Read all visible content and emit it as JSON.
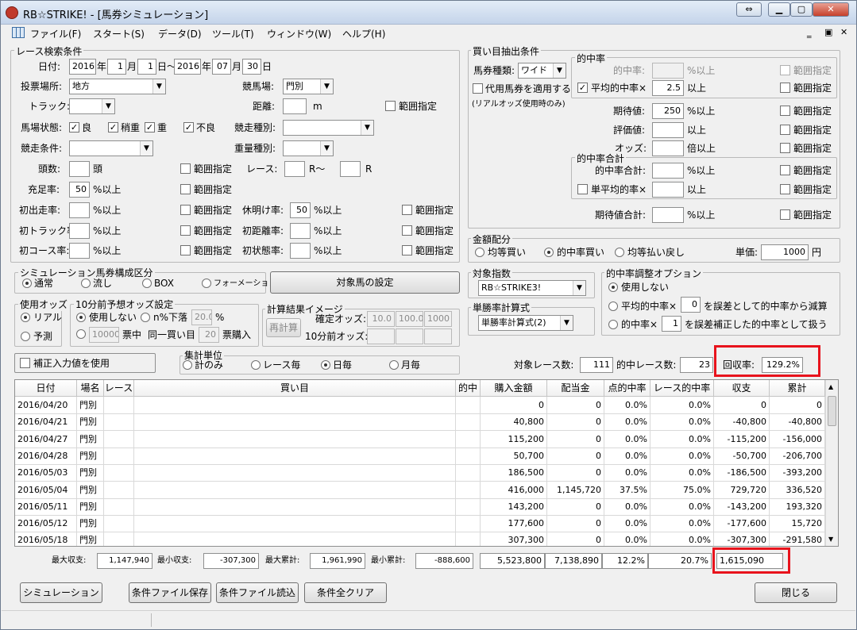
{
  "window_title": "RB☆STRIKE! - [馬券シミュレーション]",
  "menu": [
    "ファイル(F)",
    "スタート(S)",
    "データ(D)",
    "ツール(T)",
    "ウィンドウ(W)",
    "ヘルプ(H)"
  ],
  "race": {
    "group": "レース検索条件",
    "date_label": "日付:",
    "y1": "2016",
    "m1": "1",
    "d1": "1",
    "y2": "2016",
    "m2": "07",
    "d2": "30",
    "u_year": "年",
    "u_month": "月",
    "u_day1": "日～",
    "u_day2": "日",
    "vote_label": "投票場所:",
    "vote_value": "地方",
    "course_label": "競馬場:",
    "course_value": "門別",
    "track_label": "トラック:",
    "track_value": "",
    "distance_label": "距離:",
    "distance_value": "",
    "distance_unit": "m",
    "cond_label": "馬場状態:",
    "cond": [
      "良",
      "稍重",
      "重",
      "不良"
    ],
    "kind_label": "競走種別:",
    "kind_value": "",
    "race_cond_label": "競走条件:",
    "race_cond_value": "",
    "weight_label": "重量種別:",
    "weight_value": "",
    "heads_label": "頭数:",
    "heads_value": "",
    "heads_unit": "頭",
    "race_label": "レース:",
    "race_from": "",
    "race_mid": "R～",
    "race_to": "",
    "race_unit": "R",
    "fill_label": "充足率:",
    "fill_value": "50",
    "fill_unit": "%以上",
    "first_label": "初出走率:",
    "first_value": "",
    "first_unit": "%以上",
    "rest_label": "休明け率:",
    "rest_value": "50",
    "rest_unit": "%以上",
    "firsttrack_label": "初トラック率:",
    "firsttrack_value": "",
    "firsttrack_unit": "%以上",
    "firstdist_label": "初距離率:",
    "firstdist_value": "",
    "firstdist_unit": "%以上",
    "firstcourse_label": "初コース率:",
    "firstcourse_value": "",
    "firstcourse_unit": "%以上",
    "firststate_label": "初状態率:",
    "firststate_value": "",
    "firststate_unit": "%以上",
    "range": "範囲指定"
  },
  "sim": {
    "group": "シミュレーション馬券構成区分",
    "opts": [
      "通常",
      "流し",
      "BOX",
      "フォーメーション"
    ],
    "target_btn": "対象馬の設定"
  },
  "odds": {
    "group": "使用オッズ",
    "opts": [
      "リアル",
      "予測"
    ]
  },
  "pre": {
    "group": "10分前予想オッズ設定",
    "none": "使用しない",
    "drop": "n%下落",
    "drop_value": "20.0",
    "pct": "%",
    "amount": "10000",
    "amount_unit": "票中",
    "same": "同一買い目",
    "same_value": "20",
    "same_unit": "票購入"
  },
  "calc": {
    "group": "計算結果イメージ",
    "btn": "再計算",
    "fixed_label": "確定オッズ:",
    "fixed": [
      "10.0",
      "100.0",
      "1000"
    ],
    "pre_label": "10分前オッズ:"
  },
  "correct": "補正入力値を使用",
  "agg": {
    "group": "集計単位",
    "opts": [
      "計のみ",
      "レース毎",
      "日毎",
      "月毎"
    ]
  },
  "buy": {
    "group": "買い目抽出条件",
    "type_label": "馬券種類:",
    "type_value": "ワイド",
    "sub": "代用馬券を適用する",
    "sub_note": "(リアルオッズ使用時のみ)",
    "hit_group": "的中率",
    "hit_label": "的中率:",
    "hit_unit": "%以上",
    "avg_label": "平均的中率×",
    "avg_value": "2.5",
    "avg_unit": "以上",
    "exp_label": "期待値:",
    "exp_value": "250",
    "exp_unit": "%以上",
    "eval_label": "評価値:",
    "eval_unit": "以上",
    "odds_label": "オッズ:",
    "odds_unit": "倍以上",
    "total_group": "的中率合計",
    "total_label": "的中率合計:",
    "total_unit": "%以上",
    "savg_label": "単平均的率×",
    "savg_unit": "以上",
    "exptotal_label": "期待値合計:",
    "exptotal_unit": "%以上"
  },
  "money": {
    "group": "金額配分",
    "opts": [
      "均等買い",
      "的中率買い",
      "均等払い戻し"
    ],
    "unit_label": "単価:",
    "unit_value": "1000",
    "yen": "円"
  },
  "index": {
    "group": "対象指数",
    "value": "RB☆STRIKE3!"
  },
  "adjust": {
    "group": "的中率調整オプション",
    "none": "使用しない",
    "avg": "平均的中率×",
    "avg_value": "0",
    "avg_tail": "を誤差として的中率から減算",
    "hit": "的中率×",
    "hit_value": "1",
    "hit_tail": "を誤差補正した的中率として扱う"
  },
  "single": {
    "group": "単勝率計算式",
    "value": "単勝率計算式(2)"
  },
  "summary": {
    "races_label": "対象レース数:",
    "races": "111",
    "hits_label": "的中レース数:",
    "hits": "23",
    "return_label": "回収率:",
    "return": "129.2%"
  },
  "table": {
    "headers": [
      "日付",
      "場名",
      "レース",
      "買い目",
      "的中",
      "購入金額",
      "配当金",
      "点的中率",
      "レース的中率",
      "収支",
      "累計"
    ],
    "rows": [
      [
        "2016/04/20",
        "門別",
        "",
        "",
        "",
        "0",
        "0",
        "0.0%",
        "0.0%",
        "0",
        "0"
      ],
      [
        "2016/04/21",
        "門別",
        "",
        "",
        "",
        "40,800",
        "0",
        "0.0%",
        "0.0%",
        "-40,800",
        "-40,800"
      ],
      [
        "2016/04/27",
        "門別",
        "",
        "",
        "",
        "115,200",
        "0",
        "0.0%",
        "0.0%",
        "-115,200",
        "-156,000"
      ],
      [
        "2016/04/28",
        "門別",
        "",
        "",
        "",
        "50,700",
        "0",
        "0.0%",
        "0.0%",
        "-50,700",
        "-206,700"
      ],
      [
        "2016/05/03",
        "門別",
        "",
        "",
        "",
        "186,500",
        "0",
        "0.0%",
        "0.0%",
        "-186,500",
        "-393,200"
      ],
      [
        "2016/05/04",
        "門別",
        "",
        "",
        "",
        "416,000",
        "1,145,720",
        "37.5%",
        "75.0%",
        "729,720",
        "336,520"
      ],
      [
        "2016/05/11",
        "門別",
        "",
        "",
        "",
        "143,200",
        "0",
        "0.0%",
        "0.0%",
        "-143,200",
        "193,320"
      ],
      [
        "2016/05/12",
        "門別",
        "",
        "",
        "",
        "177,600",
        "0",
        "0.0%",
        "0.0%",
        "-177,600",
        "15,720"
      ],
      [
        "2016/05/18",
        "門別",
        "",
        "",
        "",
        "307,300",
        "0",
        "0.0%",
        "0.0%",
        "-307,300",
        "-291,580"
      ]
    ]
  },
  "totals": {
    "max_label": "最大収支:",
    "max": "1,147,940",
    "min_label": "最小収支:",
    "min": "-307,300",
    "maxc_label": "最大累計:",
    "maxc": "1,961,990",
    "minc_label": "最小累計:",
    "minc": "-888,600",
    "buy": "5,523,800",
    "pay": "7,138,890",
    "pt": "12.2%",
    "rt": "20.7%",
    "balance": "1,615,090"
  },
  "buttons": {
    "sim": "シミュレーション",
    "save": "条件ファイル保存",
    "load": "条件ファイル読込",
    "clear": "条件全クリア",
    "close": "閉じる"
  }
}
